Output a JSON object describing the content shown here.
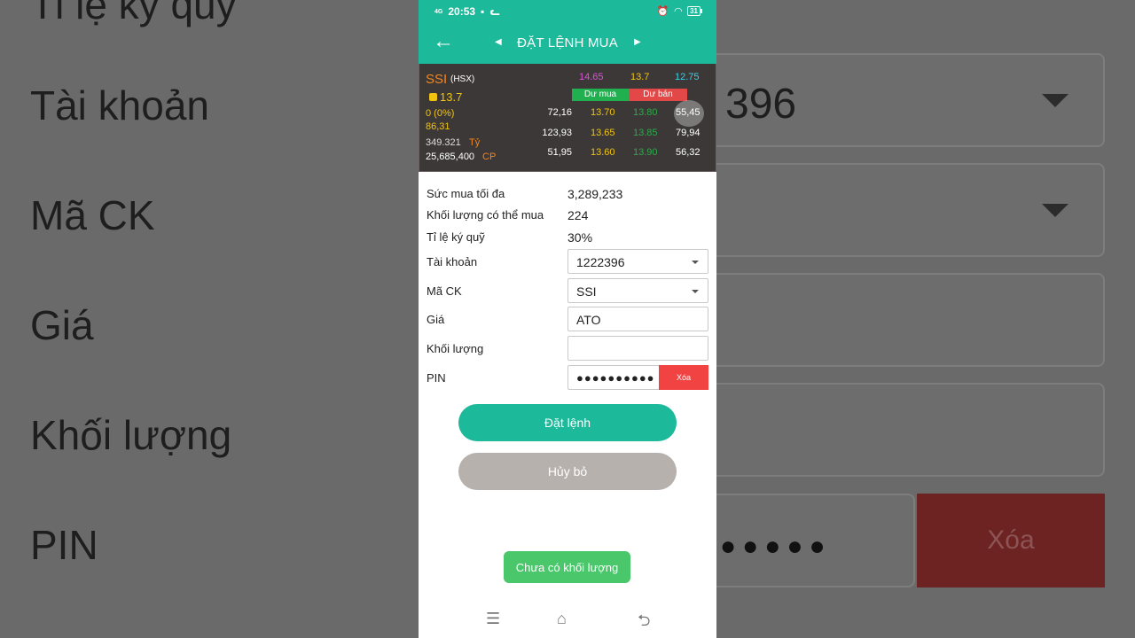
{
  "background": {
    "labels": [
      "Tỉ lệ ký quỹ",
      "Tài khoản",
      "Mã CK",
      "Giá",
      "Khối lượng",
      "PIN"
    ],
    "account_partial": "396",
    "pin_dots": "●●●●●",
    "clear_label": "Xóa"
  },
  "status_bar": {
    "network": "4G",
    "time": "20:53",
    "battery": "31"
  },
  "header": {
    "title": "ĐẶT LỆNH MUA"
  },
  "quote": {
    "symbol": "SSI",
    "exchange": "(HSX)",
    "price": "13.7",
    "change": "0 (0%)",
    "index": "86,31",
    "value": "349.321",
    "value_unit": "Tỷ",
    "volume": "25,685,400",
    "volume_unit": "CP",
    "ceiling": "14.65",
    "reference": "13.7",
    "floor": "12.75",
    "buy_label": "Dư mua",
    "sell_label": "Dư bán",
    "book": [
      {
        "buy_qty": "72,16",
        "buy_price": "13.70",
        "sell_price": "13.80",
        "sell_qty": "55,45"
      },
      {
        "buy_qty": "123,93",
        "buy_price": "13.65",
        "sell_price": "13.85",
        "sell_qty": "79,94"
      },
      {
        "buy_qty": "51,95",
        "buy_price": "13.60",
        "sell_price": "13.90",
        "sell_qty": "56,32"
      }
    ]
  },
  "form": {
    "max_buy_label": "Sức mua tối đa",
    "max_buy_value": "3,289,233",
    "buyable_qty_label": "Khối lượng có thể mua",
    "buyable_qty_value": "224",
    "margin_label": "Tỉ lệ ký quỹ",
    "margin_value": "30%",
    "account_label": "Tài khoản",
    "account_value": "1222396",
    "symbol_label": "Mã CK",
    "symbol_value": "SSI",
    "price_label": "Giá",
    "price_value": "ATO",
    "quantity_label": "Khối lượng",
    "quantity_value": "",
    "pin_label": "PIN",
    "pin_value": "●●●●●●●●●●",
    "clear_label": "Xóa"
  },
  "buttons": {
    "place_order": "Đặt lệnh",
    "cancel": "Hủy bỏ"
  },
  "toast": "Chưa có khối lượng",
  "colors": {
    "primary": "#1cb99a",
    "danger": "#f24343",
    "buy": "#20b050",
    "sell": "#e34848",
    "toast": "#49c76a"
  }
}
